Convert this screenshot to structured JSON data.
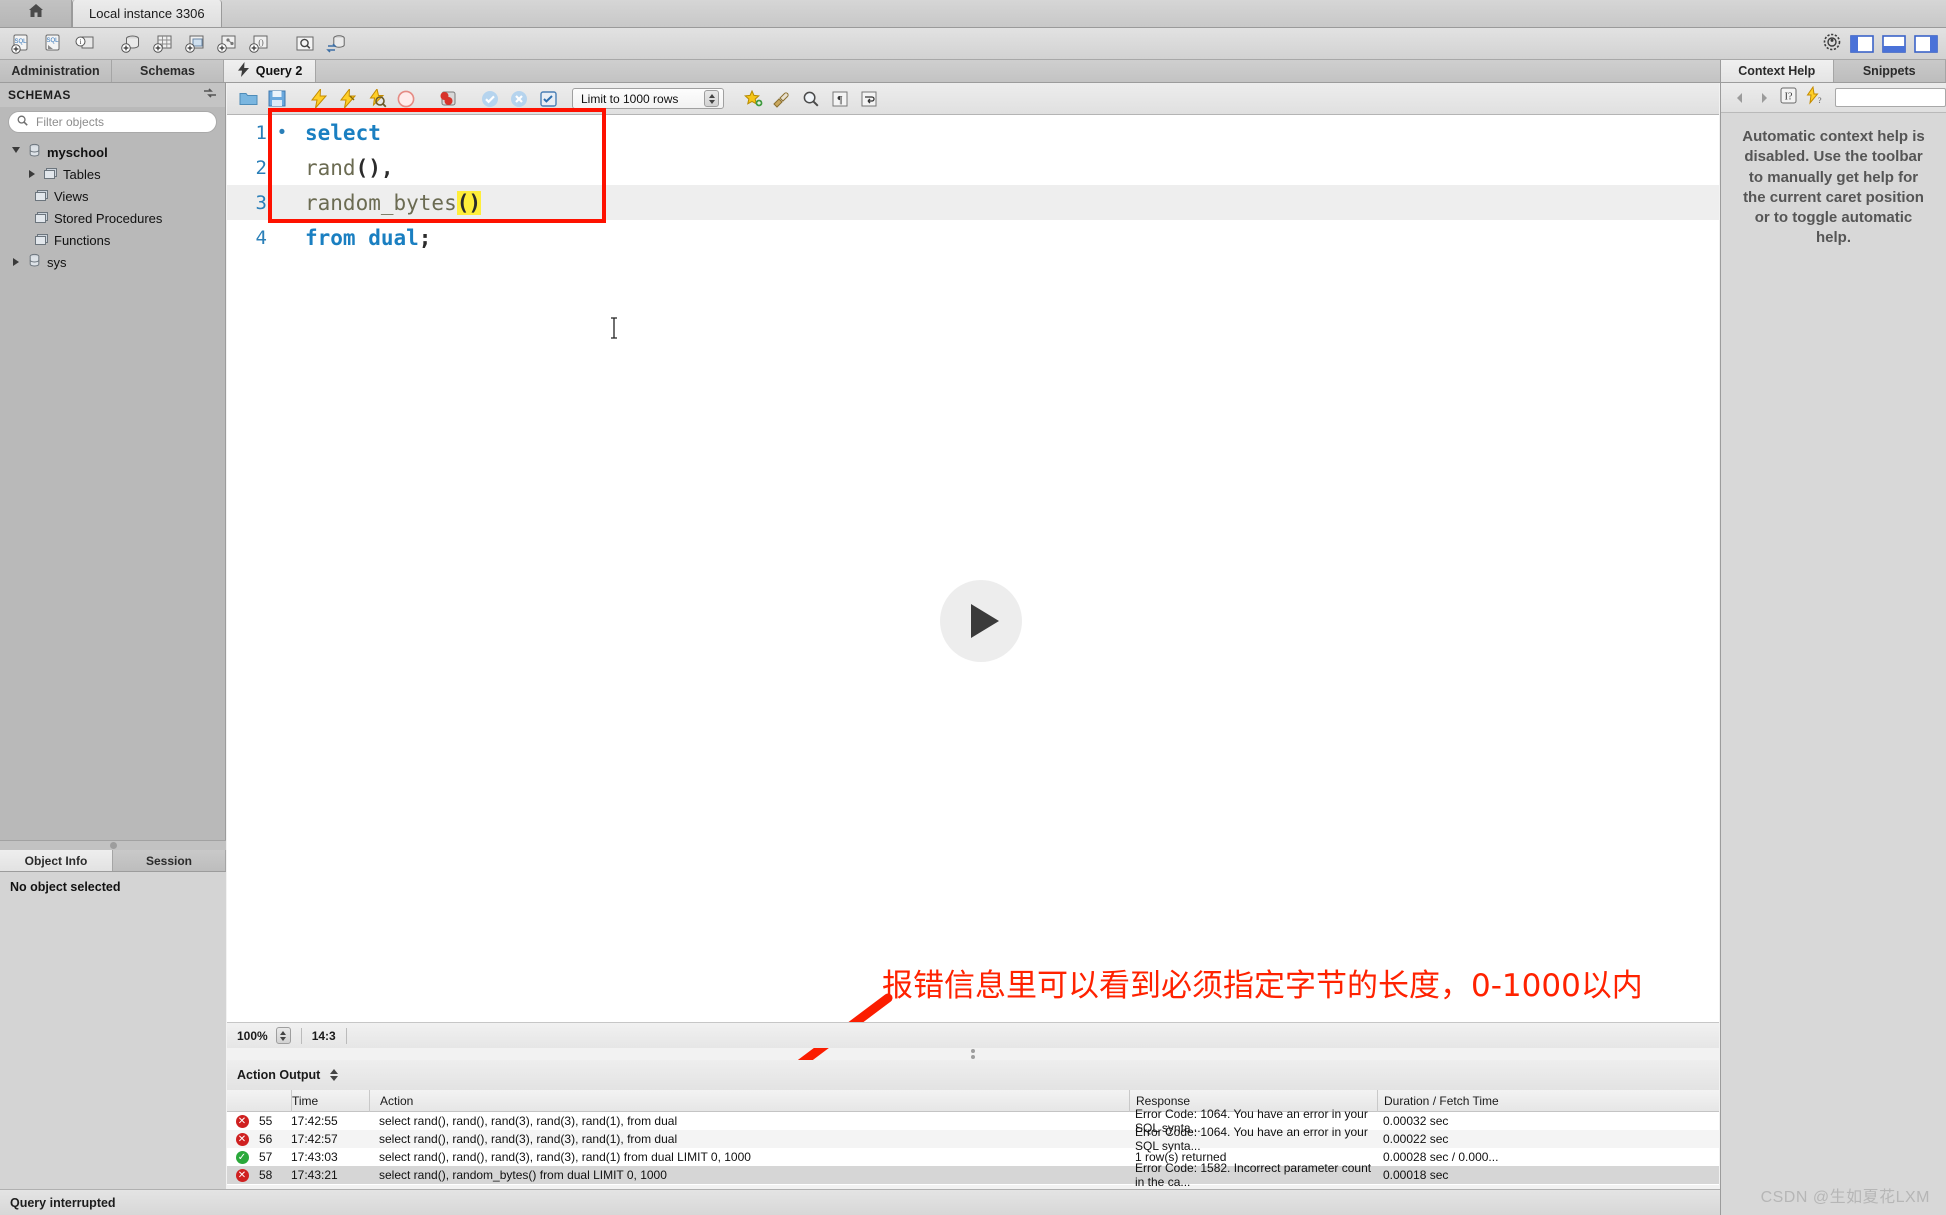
{
  "titlebar": {
    "home_icon": "home-icon",
    "instance_tab": "Local instance 3306"
  },
  "main_toolbar": {
    "buttons": [
      {
        "name": "new-sql-tab-icon",
        "title": "SQL+"
      },
      {
        "name": "open-sql-script-icon",
        "title": "SQL open"
      },
      {
        "name": "server-status-icon",
        "title": "Server info"
      },
      {
        "name": "new-schema-icon",
        "title": "New schema"
      },
      {
        "name": "new-table-icon",
        "title": "New table"
      },
      {
        "name": "new-view-icon",
        "title": "New view"
      },
      {
        "name": "new-procedure-icon",
        "title": "New procedure"
      },
      {
        "name": "new-function-icon",
        "title": "New function"
      },
      {
        "name": "search-data-icon",
        "title": "Search table data"
      },
      {
        "name": "reconnect-icon",
        "title": "Reconnect to DBMS"
      }
    ],
    "right_controls": [
      {
        "name": "admin-gear-icon"
      },
      {
        "name": "toggle-sidebar-icon"
      },
      {
        "name": "toggle-output-icon"
      },
      {
        "name": "toggle-secondary-sidebar-icon"
      }
    ]
  },
  "tabs": [
    {
      "label": "Administration",
      "selected": false
    },
    {
      "label": "Schemas",
      "selected": false
    },
    {
      "label": "Query 2",
      "selected": true
    }
  ],
  "sidebar": {
    "header": "SCHEMAS",
    "refresh_icon": "refresh-icon",
    "filter": {
      "placeholder": "Filter objects",
      "value": "",
      "icon": "search-icon"
    },
    "tree": [
      {
        "label": "myschool",
        "level": 0,
        "expanded": true,
        "icon": "database-icon",
        "bold": true
      },
      {
        "label": "Tables",
        "level": 1,
        "expanded": false,
        "icon": "folder-icon",
        "bold": false
      },
      {
        "label": "Views",
        "level": 2,
        "expanded": null,
        "icon": "folder-icon",
        "bold": false
      },
      {
        "label": "Stored Procedures",
        "level": 2,
        "expanded": null,
        "icon": "folder-icon",
        "bold": false
      },
      {
        "label": "Functions",
        "level": 2,
        "expanded": null,
        "icon": "folder-icon",
        "bold": false
      },
      {
        "label": "sys",
        "level": 0,
        "expanded": false,
        "icon": "database-icon",
        "bold": false
      }
    ],
    "bottom_tabs": [
      {
        "label": "Object Info",
        "selected": true
      },
      {
        "label": "Session",
        "selected": false
      }
    ],
    "object_info_text": "No object selected"
  },
  "query_toolbar": {
    "buttons": [
      {
        "name": "open-script-icon"
      },
      {
        "name": "save-script-icon"
      },
      {
        "name": "execute-statement-icon"
      },
      {
        "name": "execute-current-statement-icon"
      },
      {
        "name": "explain-statement-icon"
      },
      {
        "name": "stop-execution-icon"
      },
      {
        "name": "toggle-stop-on-error-icon"
      },
      {
        "name": "commit-icon"
      },
      {
        "name": "rollback-icon"
      },
      {
        "name": "autocommit-icon"
      }
    ],
    "limit_select": {
      "value": "Limit to 1000 rows"
    },
    "right_buttons": [
      {
        "name": "add-snippet-icon"
      },
      {
        "name": "beautify-sql-icon"
      },
      {
        "name": "find-icon"
      },
      {
        "name": "toggle-invisible-chars-icon"
      },
      {
        "name": "wrap-lines-icon"
      }
    ]
  },
  "editor": {
    "lines": [
      {
        "num": "1",
        "marker": "•",
        "highlight": false,
        "tokens": [
          {
            "t": "select",
            "c": "kw"
          }
        ]
      },
      {
        "num": "2",
        "marker": "",
        "highlight": false,
        "tokens": [
          {
            "t": "rand",
            "c": "fn"
          },
          {
            "t": "(),",
            "c": "pn"
          }
        ]
      },
      {
        "num": "3",
        "marker": "",
        "highlight": true,
        "tokens": [
          {
            "t": "random_bytes",
            "c": "fn"
          },
          {
            "t": "(",
            "c": "paren"
          },
          {
            "t": "caret",
            "c": "caret"
          },
          {
            "t": ")",
            "c": "paren"
          }
        ]
      },
      {
        "num": "4",
        "marker": "",
        "highlight": false,
        "tokens": [
          {
            "t": "from dual",
            "c": "kw"
          },
          {
            "t": ";",
            "c": "pn"
          }
        ]
      }
    ],
    "status": {
      "zoom": "100%",
      "caret_position": "14:3"
    }
  },
  "annotation": {
    "text": "报错信息里可以看到必须指定字节的长度，0-1000以内",
    "color": "#ff2200",
    "arrow_icon": "arrow-pointer-icon"
  },
  "action_output": {
    "title": "Action Output",
    "columns": [
      "",
      "",
      "Time",
      "Action",
      "Response",
      "Duration / Fetch Time"
    ],
    "rows": [
      {
        "status": "error",
        "no": "55",
        "time": "17:42:55",
        "action": "select  rand(), rand(), rand(3), rand(3), rand(1), from dual",
        "response": "Error Code: 1064. You have an error in your SQL synta...",
        "duration": "0.00032 sec",
        "selected": false
      },
      {
        "status": "error",
        "no": "56",
        "time": "17:42:57",
        "action": "select  rand(), rand(), rand(3), rand(3), rand(1), from dual",
        "response": "Error Code: 1064. You have an error in your SQL synta...",
        "duration": "0.00022 sec",
        "selected": false
      },
      {
        "status": "ok",
        "no": "57",
        "time": "17:43:03",
        "action": "select  rand(), rand(), rand(3), rand(3), rand(1) from dual LIMIT 0, 1000",
        "response": "1 row(s) returned",
        "duration": "0.00028 sec / 0.000...",
        "selected": false
      },
      {
        "status": "error",
        "no": "58",
        "time": "17:43:21",
        "action": "select  rand(), random_bytes() from dual LIMIT 0, 1000",
        "response": "Error Code: 1582. Incorrect parameter count in the ca...",
        "duration": "0.00018 sec",
        "selected": true
      }
    ]
  },
  "right_panel": {
    "tabs": [
      {
        "label": "Context Help",
        "selected": true
      },
      {
        "label": "Snippets",
        "selected": false
      }
    ],
    "toolbar": [
      {
        "name": "back-arrow-icon"
      },
      {
        "name": "forward-arrow-icon"
      },
      {
        "name": "context-help-icon"
      },
      {
        "name": "auto-help-toggle-icon"
      }
    ],
    "search_value": "",
    "body_text": "Automatic context help is disabled. Use the toolbar to manually get help for the current caret position or to toggle automatic help."
  },
  "status_bar": {
    "text": "Query interrupted"
  },
  "watermark": {
    "text": "CSDN @生如夏花LXM"
  },
  "play_overlay": {
    "name": "play-button-icon"
  }
}
